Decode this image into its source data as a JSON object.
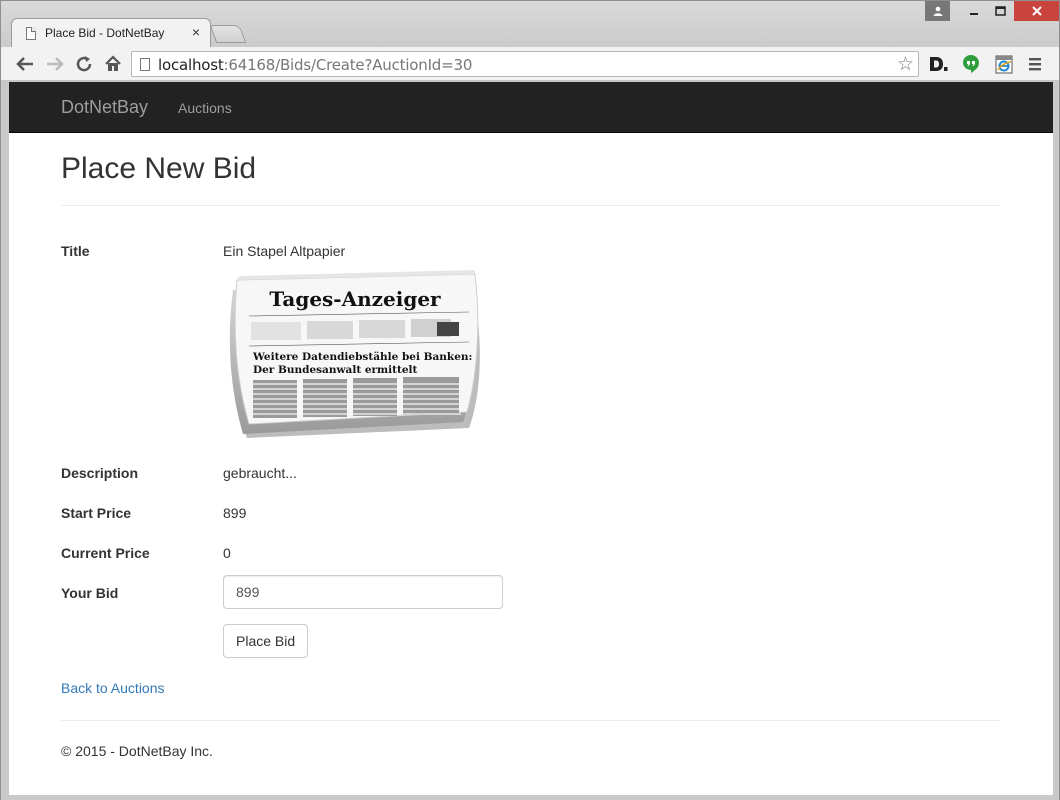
{
  "browser": {
    "tab_title": "Place Bid - DotNetBay",
    "tab_close": "×",
    "url_host": "localhost",
    "url_rest": ":64168/Bids/Create?AuctionId=30"
  },
  "navbar": {
    "brand": "DotNetBay",
    "links": [
      "Auctions"
    ]
  },
  "page": {
    "heading": "Place New Bid",
    "fields": {
      "title_label": "Title",
      "title_value": "Ein Stapel Altpapier",
      "description_label": "Description",
      "description_value": "gebraucht...",
      "start_price_label": "Start Price",
      "start_price_value": "899",
      "current_price_label": "Current Price",
      "current_price_value": "0",
      "your_bid_label": "Your Bid",
      "your_bid_value": "899"
    },
    "image": {
      "masthead": "Tages-Anzeiger",
      "headline_1": "Weitere Datendiebstähle bei Banken:",
      "headline_2": "Der Bundesanwalt ermittelt"
    },
    "submit_label": "Place Bid",
    "back_link": "Back to Auctions",
    "footer": "© 2015 - DotNetBay Inc."
  },
  "colors": {
    "navbar_bg": "#222222",
    "link": "#337ab7",
    "close_button": "#c9443c"
  }
}
